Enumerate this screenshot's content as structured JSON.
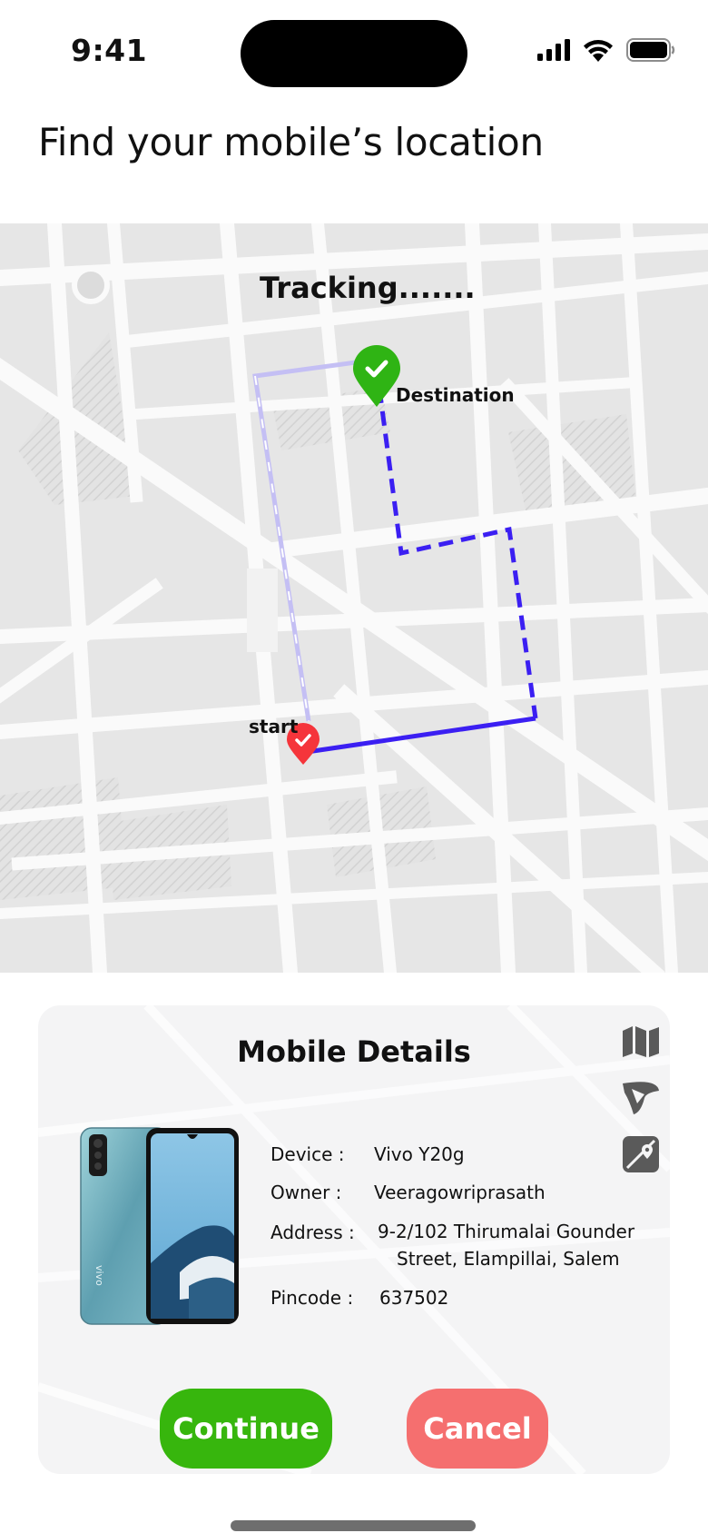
{
  "status_bar": {
    "time": "9:41"
  },
  "page": {
    "title": "Find your mobile’s location"
  },
  "map": {
    "tracking_text": "Tracking.......",
    "destination_label": "Destination",
    "start_label": "start",
    "route_color": "#3b1ff2",
    "alt_route_color": "#c4bff4",
    "destination_pin_color": "#2fb414",
    "start_pin_color": "#f5353b"
  },
  "details": {
    "title": "Mobile Details",
    "icons": [
      "map-icon",
      "navigation-icon",
      "location-image-icon"
    ],
    "device_label": "Device :",
    "device_value": "Vivo Y20g",
    "owner_label": "Owner :",
    "owner_value": "Veeragowriprasath",
    "address_label": "Address :",
    "address_line1": "9-2/102 Thirumalai Gounder",
    "address_line2": "Street, Elampillai, Salem",
    "pincode_label": "Pincode :",
    "pincode_value": "637502",
    "phone_brand": "vivo"
  },
  "actions": {
    "continue_label": "Continue",
    "cancel_label": "Cancel",
    "continue_color": "#37b60d",
    "cancel_color": "#f56f6f"
  }
}
